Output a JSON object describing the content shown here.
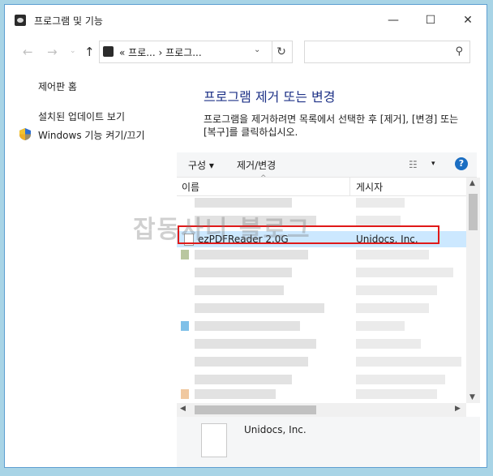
{
  "window": {
    "title": "프로그램 및 기능",
    "controls": {
      "minimize": "—",
      "maximize": "☐",
      "close": "✕"
    }
  },
  "nav": {
    "back": "←",
    "forward": "→",
    "recent": "⌄",
    "up": "↑",
    "address": "« 프로...  ›  프로그...",
    "address_chevron": "⌄",
    "refresh": "↻",
    "search_placeholder": "",
    "search_icon": "⚲"
  },
  "left_pane": {
    "links": [
      "제어판 홈",
      "설치된 업데이트 보기",
      "Windows 기능 켜기/끄기"
    ]
  },
  "main": {
    "heading": "프로그램 제거 또는 변경",
    "description": "프로그램을 제거하려면 목록에서 선택한 후 [제거], [변경] 또는 [복구]를 클릭하십시오."
  },
  "toolbar": {
    "organize": "구성 ▾",
    "uninstall_change": "제거/변경",
    "view_icon": "☷",
    "view_dropdown": "▾",
    "help": "?"
  },
  "columns": {
    "name": "이름",
    "publisher": "게시자",
    "sort_indicator": "^"
  },
  "selected_program": {
    "name": "ezPDFReader 2.0G",
    "publisher": "Unidocs, Inc."
  },
  "watermark": "잡동사니 블로그",
  "scroll": {
    "up": "▲",
    "down": "▼",
    "left": "◀",
    "right": "▶"
  },
  "details": {
    "publisher": "Unidocs, Inc."
  },
  "colors": {
    "accent": "#1e3287",
    "selection": "#cce8ff",
    "highlight_box": "#e01919"
  }
}
